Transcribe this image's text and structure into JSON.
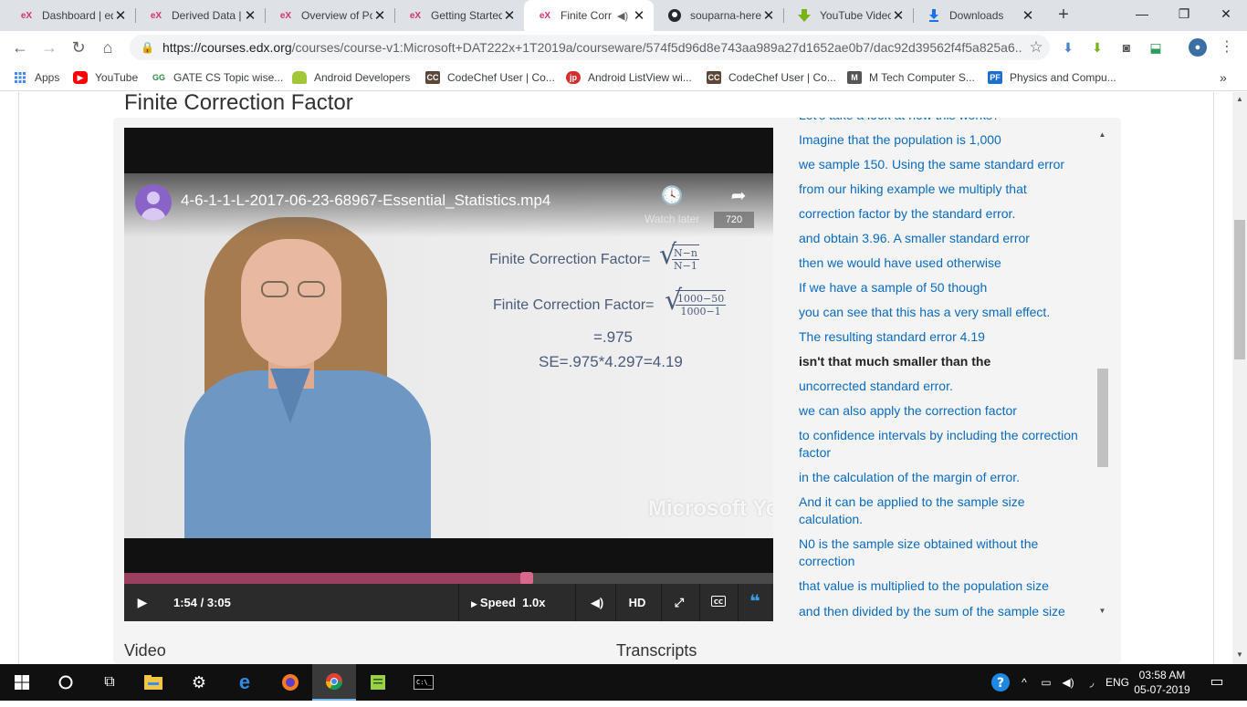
{
  "tabs": [
    {
      "title": "Dashboard | edX",
      "favicon": "edx-logo",
      "color": "#d5326f",
      "active": false
    },
    {
      "title": "Derived Data | ",
      "favicon": "edx-logo",
      "color": "#d5326f",
      "active": false
    },
    {
      "title": "Overview of Po",
      "favicon": "edx-logo",
      "color": "#d5326f",
      "active": false
    },
    {
      "title": "Getting Started",
      "favicon": "edx-logo",
      "color": "#d5326f",
      "active": false
    },
    {
      "title": "Finite Corr",
      "favicon": "edx-logo",
      "color": "#d5326f",
      "active": true,
      "audio": true
    },
    {
      "title": "souparna-here",
      "favicon": "github-icon",
      "color": "#24292e",
      "active": false
    },
    {
      "title": "YouTube Video",
      "favicon": "download-arrow-green",
      "color": "#7ab317",
      "active": false
    },
    {
      "title": "Downloads",
      "favicon": "download-icon",
      "color": "#1a73e8",
      "active": false
    }
  ],
  "toolbar": {
    "url_host": "https://courses.edx.org",
    "url_path": "/courses/course-v1:Microsoft+DAT222x+1T2019a/courseware/574f5d96d8e743aa989a27d1652ae0b7/dac92d39562f4f5a825a6..."
  },
  "bookmarks": [
    {
      "label": "Apps",
      "icon": "apps-grid-icon",
      "color": "#4285f4"
    },
    {
      "label": "YouTube",
      "icon": "youtube-icon",
      "color": "#ff0000"
    },
    {
      "label": "GATE CS Topic wise...",
      "icon": "gfg-icon",
      "color": "#2f8d46"
    },
    {
      "label": "Android Developers",
      "icon": "android-icon",
      "color": "#a4c639"
    },
    {
      "label": "CodeChef User | Co...",
      "icon": "codechef-icon",
      "color": "#5b4638"
    },
    {
      "label": "Android ListView wi...",
      "icon": "jp-icon",
      "color": "#d32f2f"
    },
    {
      "label": "CodeChef User | Co...",
      "icon": "codechef-icon",
      "color": "#5b4638"
    },
    {
      "label": "M Tech Computer S...",
      "icon": "site-icon",
      "color": "#555555"
    },
    {
      "label": "Physics and Compu...",
      "icon": "pf-icon",
      "color": "#1e6ed2"
    }
  ],
  "page": {
    "unit_title": "Finite Correction Factor",
    "video_label": "Video",
    "transcripts_label": "Transcripts"
  },
  "video": {
    "yt_title": "4-6-1-1-L-2017-06-23-68967-Essential_Statistics.mp4",
    "watch_later": "Watch later",
    "quality": "720",
    "formula1_label": "Finite Correction Factor=",
    "formula1_num": "N−n",
    "formula1_den": "N−1",
    "formula2_label": "Finite Correction Factor=",
    "formula2_num": "1000−50",
    "formula2_den": "1000−1",
    "result": "=.975",
    "se": "SE=.975*4.297=4.19",
    "brand": "Microsoft  YouTube",
    "time": "1:54 / 3:05",
    "progress_fraction": 0.62,
    "speed_label": "Speed",
    "speed_value": "1.0x",
    "hd": "HD"
  },
  "transcript": [
    {
      "text": "Let's take a look at how this works?",
      "current": false
    },
    {
      "text": "Imagine that the population is 1,000",
      "current": false
    },
    {
      "text": "we sample 150. Using the same standard error",
      "current": false
    },
    {
      "text": "from our hiking example we multiply that",
      "current": false
    },
    {
      "text": "correction factor by the standard error.",
      "current": false
    },
    {
      "text": "and obtain 3.96. A smaller standard error",
      "current": false
    },
    {
      "text": "then we would have used otherwise",
      "current": false
    },
    {
      "text": "If we have a sample of 50 though",
      "current": false
    },
    {
      "text": "you can see that this has a very small effect.",
      "current": false
    },
    {
      "text": "The resulting standard error 4.19",
      "current": false
    },
    {
      "text": "isn't that much smaller than the",
      "current": true
    },
    {
      "text": "uncorrected standard error.",
      "current": false
    },
    {
      "text": "we can also apply the correction factor",
      "current": false
    },
    {
      "text": "to confidence intervals by including the correction factor",
      "current": false
    },
    {
      "text": "in the calculation of the margin of error.",
      "current": false
    },
    {
      "text": "And it can be applied to the sample size calculation.",
      "current": false
    },
    {
      "text": "N0 is the sample size obtained without the correction",
      "current": false
    },
    {
      "text": "that value is multiplied to the population size",
      "current": false
    },
    {
      "text": "and then divided by the sum of the sample size",
      "current": false
    }
  ],
  "taskbar": {
    "language": "ENG",
    "time": "03:58 AM",
    "date": "05-07-2019"
  }
}
